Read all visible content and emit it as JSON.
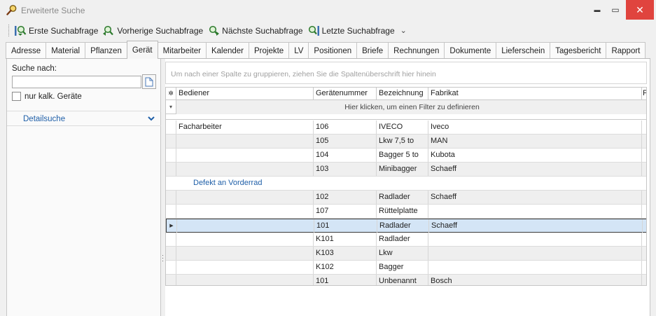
{
  "window": {
    "title": "Erweiterte Suche",
    "controls": {
      "minimize": "▬",
      "maximize": "▭",
      "close": "✕"
    }
  },
  "toolbar": {
    "buttons": [
      {
        "label": "Erste Suchabfrage",
        "icon": "first-query-icon"
      },
      {
        "label": "Vorherige Suchabfrage",
        "icon": "previous-query-icon"
      },
      {
        "label": "Nächste Suchabfrage",
        "icon": "next-query-icon"
      },
      {
        "label": "Letzte Suchabfrage",
        "icon": "last-query-icon"
      }
    ],
    "more": "⌄"
  },
  "tabs": [
    "Adresse",
    "Material",
    "Pflanzen",
    "Gerät",
    "Mitarbeiter",
    "Kalender",
    "Projekte",
    "LV",
    "Positionen",
    "Briefe",
    "Rechnungen",
    "Dokumente",
    "Lieferschein",
    "Tagesbericht",
    "Rapport"
  ],
  "active_tab": "Gerät",
  "left_panel": {
    "search_label": "Suche nach:",
    "search_value": "",
    "checkbox_label": "nur kalk. Geräte",
    "detail_label": "Detailsuche"
  },
  "grid": {
    "group_hint": "Um nach einer Spalte zu gruppieren, ziehen Sie die Spaltenüberschrift hier hinein",
    "filter_hint": "Hier klicken, um einen Filter zu definieren",
    "columns": [
      "Bediener",
      "Gerätenummer",
      "Bezeichnung",
      "Fabrikat",
      "P"
    ],
    "rows": [
      {
        "bediener": "Facharbeiter",
        "nummer": "106",
        "bezeichnung": "IVECO",
        "fabrikat": "Iveco"
      },
      {
        "bediener": "",
        "nummer": "105",
        "bezeichnung": "Lkw 7,5 to",
        "fabrikat": "MAN"
      },
      {
        "bediener": "",
        "nummer": "104",
        "bezeichnung": "Bagger 5 to",
        "fabrikat": "Kubota"
      },
      {
        "bediener": "",
        "nummer": "103",
        "bezeichnung": "Minibagger",
        "fabrikat": "Schaeff"
      },
      {
        "memo": "Defekt an Vorderrad"
      },
      {
        "bediener": "",
        "nummer": "102",
        "bezeichnung": "Radlader",
        "fabrikat": "Schaeff"
      },
      {
        "bediener": "",
        "nummer": "107",
        "bezeichnung": "Rüttelplatte",
        "fabrikat": ""
      },
      {
        "bediener": "",
        "nummer": "101",
        "bezeichnung": "Radlader",
        "fabrikat": "Schaeff",
        "selected": true
      },
      {
        "bediener": "",
        "nummer": "K101",
        "bezeichnung": "Radlader",
        "fabrikat": ""
      },
      {
        "bediener": "",
        "nummer": "K103",
        "bezeichnung": "Lkw",
        "fabrikat": ""
      },
      {
        "bediener": "",
        "nummer": "K102",
        "bezeichnung": "Bagger",
        "fabrikat": ""
      },
      {
        "bediener": "",
        "nummer": "101",
        "bezeichnung": "Unbenannt",
        "fabrikat": "Bosch"
      }
    ]
  },
  "colors": {
    "link": "#1f5fa8",
    "selection": "#d4e5f6",
    "close": "#e0443e"
  }
}
